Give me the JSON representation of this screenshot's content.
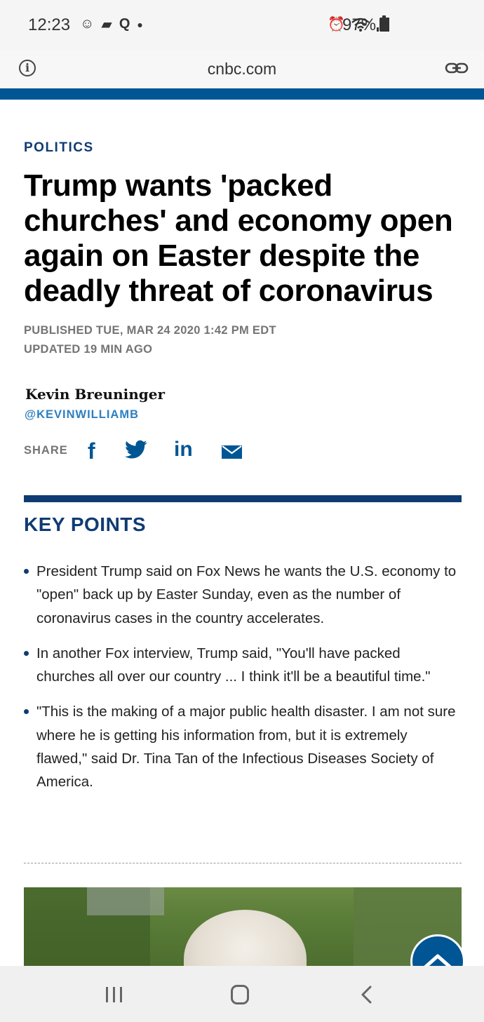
{
  "status_bar": {
    "time": "12:23",
    "battery": "97%",
    "left_icons": [
      "mascot-icon",
      "bag-icon",
      "q-icon",
      "dot-icon"
    ],
    "right_icons": [
      "alarm-icon",
      "wifi-icon",
      "signal-icon",
      "battery-icon"
    ]
  },
  "browser": {
    "url": "cnbc.com",
    "icons": [
      "info-icon",
      "link-icon"
    ]
  },
  "article": {
    "section": "POLITICS",
    "headline": "Trump wants 'packed churches' and economy open again on Easter despite the deadly threat of coronavirus",
    "published": "PUBLISHED TUE, MAR 24 2020 1:42 PM EDT",
    "updated": "UPDATED 19 MIN AGO",
    "author": {
      "name": "Kevin Breuninger",
      "handle": "@KEVINWILLIAMB"
    },
    "share": {
      "label": "SHARE",
      "icons": [
        "facebook-icon",
        "twitter-icon",
        "linkedin-icon",
        "email-icon"
      ]
    },
    "key_points": {
      "title": "KEY POINTS",
      "items": [
        "President Trump said on Fox News he wants the U.S. economy to \"open\" back up by Easter Sunday, even as the number of coronavirus cases in the country accelerates.",
        "In another Fox interview, Trump said, \"You'll have packed churches all over our country ... I think it'll be a beautiful time.\"",
        "\"This is the making of a major public health disaster. I am not sure where he is getting his information from, but it is extremely flawed,\" said Dr. Tina Tan of the Infectious Diseases Society of America."
      ]
    }
  },
  "colors": {
    "brand_blue": "#005594",
    "navy": "#0f3b73",
    "handle_blue": "#2e7fbf",
    "meta_gray": "#747474"
  },
  "nav_bar": {
    "icons": [
      "recents-icon",
      "home-icon",
      "back-icon"
    ]
  }
}
